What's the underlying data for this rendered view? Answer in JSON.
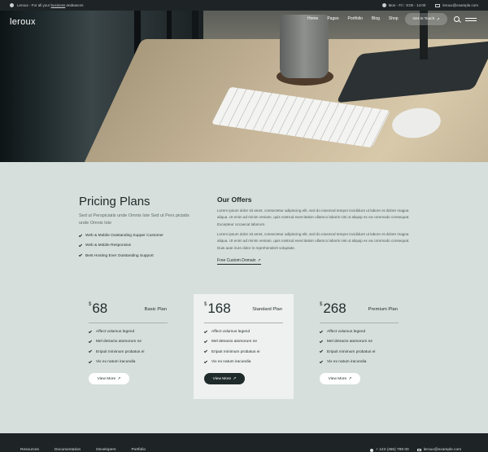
{
  "topbar": {
    "tagline_pre": "Leroux - For all your ",
    "tagline_link": "business",
    "tagline_post": " endeavors",
    "hours": "Mon - Fri : 9:00 - 14:00",
    "email": "leroux@example.com"
  },
  "header": {
    "logo": "leroux",
    "nav": [
      "Home",
      "Pages",
      "Portfolio",
      "Blog",
      "Shop"
    ],
    "cta_label": "Get In Touch"
  },
  "pricing": {
    "title": "Pricing Plans",
    "subtitle": "Sed ut Perspiciatis unde Omnis Iste Sed ut Pers piciatis unde Omnis Iste",
    "features": [
      "Web & Mobile Outstanding Supper Customer",
      "Web & Mobile Responsive",
      "Best Hosting Ever Outstanding Support"
    ]
  },
  "offers": {
    "title": "Our Offers",
    "p1": "Lorem ipsum dolor sit amet, consectetur adipiscing elit, sed do eiusmod tempor incididunt ut labore et dolore magna aliqua. Ut enim ad minim veniam, quis nostrud exercitation ullamco laboris nisi ut aliquip ex ea commodo consequat. Excepteur occaecat laborum.",
    "p2": "Lorem ipsum dolor sit amet, consectetur adipiscing elit, sed do eiusmod tempor incididunt ut labore et dolore magna aliqua. Ut enim ad minim veniam, quis nostrud exercitation ullamco laboris nisi ut aliquip ex ea commodo consequat. Duis aute irure dolor in reprehenderit voluptate.",
    "link": "Free Custom Domain"
  },
  "plans": [
    {
      "currency": "$",
      "amount": "68",
      "name": "Basic Plan",
      "features": [
        "Affect volumus legend",
        "Mel detracto atomorum ne",
        "Eripuit minimum probatus ei",
        "Vix ex natum iracundia"
      ],
      "button": "View More"
    },
    {
      "currency": "$",
      "amount": "168",
      "name": "Standard Plan",
      "features": [
        "Affect volumus legend",
        "Mel detracto atomorum ne",
        "Eripuit minimum probatus ei",
        "Vix ex natum iracundia"
      ],
      "button": "View More"
    },
    {
      "currency": "$",
      "amount": "268",
      "name": "Premium Plan",
      "features": [
        "Affect volumus legend",
        "Mel detracto atomorum ne",
        "Eripuit minimum probatus ei",
        "Vix ex natum iracundia"
      ],
      "button": "View More"
    }
  ],
  "footer": {
    "links": [
      "Resources",
      "Documentation",
      "Developers",
      "Portfolio"
    ],
    "phone": "+ 123 (456) 789 00",
    "email": "leroux@example.com"
  },
  "colors": {
    "background": "#d6dfdb",
    "dark": "#1e2426",
    "featured_card": "#eef1ef"
  }
}
